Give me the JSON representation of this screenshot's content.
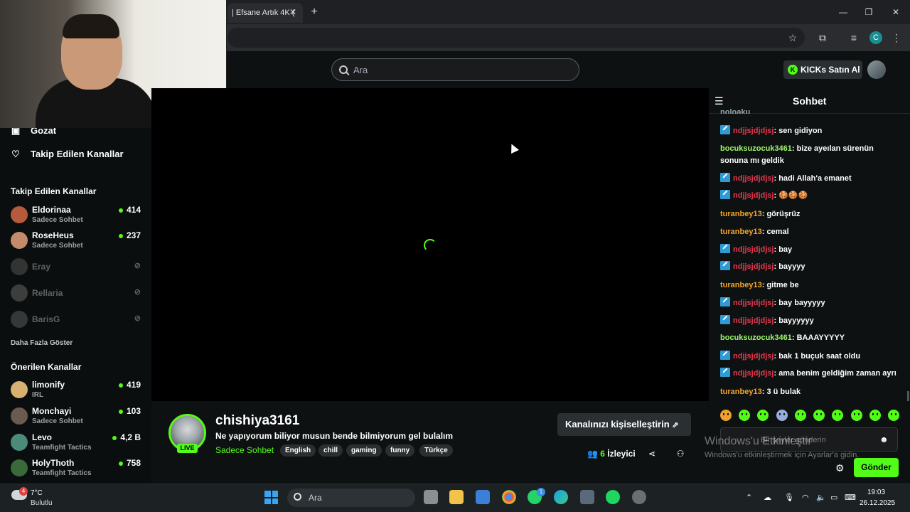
{
  "browser": {
    "tab_title": "| Efsane Artık 4K ("
  },
  "header": {
    "search_placeholder": "Ara",
    "kicks_label": "KICKs Satın Al"
  },
  "sidebar": {
    "nav": [
      {
        "label": "Gozat",
        "icon": "browse-icon"
      },
      {
        "label": "Takip Edilen Kanallar",
        "icon": "heart-icon"
      }
    ],
    "followed_title": "Takip Edilen Kanallar",
    "followed": [
      {
        "name": "Eldorinaa",
        "sub": "Sadece Sohbet",
        "viewers": "414",
        "live": true,
        "color": "#b55a3a"
      },
      {
        "name": "RoseHeus",
        "sub": "Sadece Sohbet",
        "viewers": "237",
        "live": true,
        "color": "#c48a6a"
      },
      {
        "name": "Eray",
        "sub": "",
        "viewers": "",
        "live": false,
        "color": "#7a7a7a"
      },
      {
        "name": "Rellaria",
        "sub": "",
        "viewers": "",
        "live": false,
        "color": "#999999"
      },
      {
        "name": "BarisG",
        "sub": "",
        "viewers": "",
        "live": false,
        "color": "#888888"
      }
    ],
    "show_more": "Daha Fazla Göster",
    "recommended_title": "Önerilen Kanallar",
    "recommended": [
      {
        "name": "limonify",
        "sub": "IRL",
        "viewers": "419",
        "color": "#d8b070"
      },
      {
        "name": "Monchayi",
        "sub": "Sadece Sohbet",
        "viewers": "103",
        "color": "#6a5a50"
      },
      {
        "name": "Levo",
        "sub": "Teamfight Tactics",
        "viewers": "4,2 B",
        "color": "#4c8a7a"
      },
      {
        "name": "HolyThoth",
        "sub": "Teamfight Tactics",
        "viewers": "758",
        "color": "#3a6a3a"
      }
    ]
  },
  "stream": {
    "streamer": "chishiya3161",
    "live_badge": "LIVE",
    "title": "Ne yapıyorum biliyor musun bende bilmiyorum gel bulalım",
    "category": "Sadece Sohbet",
    "tags": [
      "English",
      "chill",
      "gaming",
      "funny",
      "Türkçe"
    ],
    "customize_label": "Kanalınızı kişiselleştirin",
    "viewer_count": "6",
    "viewer_label": "İzleyici"
  },
  "chat": {
    "title": "Sohbet",
    "partial_top": "noloaku",
    "messages": [
      {
        "user": "ndjjsjdjdjsj",
        "text": "sen gidiyon",
        "color": "red",
        "badge": true
      },
      {
        "user": "bocuksuzocuk3461",
        "text": "bize ayeılan sürenün sonuna mı geldik",
        "color": "green",
        "badge": false
      },
      {
        "user": "ndjjsjdjdjsj",
        "text": "hadi Allah'a emanet",
        "color": "red",
        "badge": true
      },
      {
        "user": "ndjjsjdjdjsj",
        "text": "🍪🍪🍪",
        "color": "red",
        "badge": true
      },
      {
        "user": "turanbey13",
        "text": "görüşrüz",
        "color": "orange",
        "badge": false
      },
      {
        "user": "turanbey13",
        "text": "cemal",
        "color": "orange",
        "badge": false
      },
      {
        "user": "ndjjsjdjdjsj",
        "text": "bay",
        "color": "red",
        "badge": true
      },
      {
        "user": "ndjjsjdjdjsj",
        "text": "bayyyy",
        "color": "red",
        "badge": true
      },
      {
        "user": "turanbey13",
        "text": "gitme be",
        "color": "orange",
        "badge": false
      },
      {
        "user": "ndjjsjdjdjsj",
        "text": "bay bayyyyy",
        "color": "red",
        "badge": true
      },
      {
        "user": "ndjjsjdjdjsj",
        "text": "bayyyyyy",
        "color": "red",
        "badge": true
      },
      {
        "user": "bocuksuzocuk3461",
        "text": "BAAAYYYYY",
        "color": "green",
        "badge": false
      },
      {
        "user": "ndjjsjdjdjsj",
        "text": "bak 1 buçuk saat oldu",
        "color": "red",
        "badge": true
      },
      {
        "user": "ndjjsjdjdjsj",
        "text": "ama benim geldiğim zaman ayrı",
        "color": "red",
        "badge": true
      },
      {
        "user": "turanbey13",
        "text": "3 ü bulak",
        "color": "orange",
        "badge": false
      }
    ],
    "input_placeholder": "Bir şeyler gönderin",
    "send_label": "Gönder"
  },
  "watermark": {
    "line1": "Windows'u Etkinleştir",
    "line2": "Windows'u etkinleştirmek için Ayarlar'a gidin."
  },
  "taskbar": {
    "temperature": "7°C",
    "condition": "Bulutlu",
    "weather_badge": "4",
    "search_placeholder": "Ara",
    "whatsapp_badge": "1",
    "time": "19:03",
    "date": "26.12.2025"
  },
  "colors": {
    "accent": "#53fc18",
    "background": "#0e1112"
  }
}
